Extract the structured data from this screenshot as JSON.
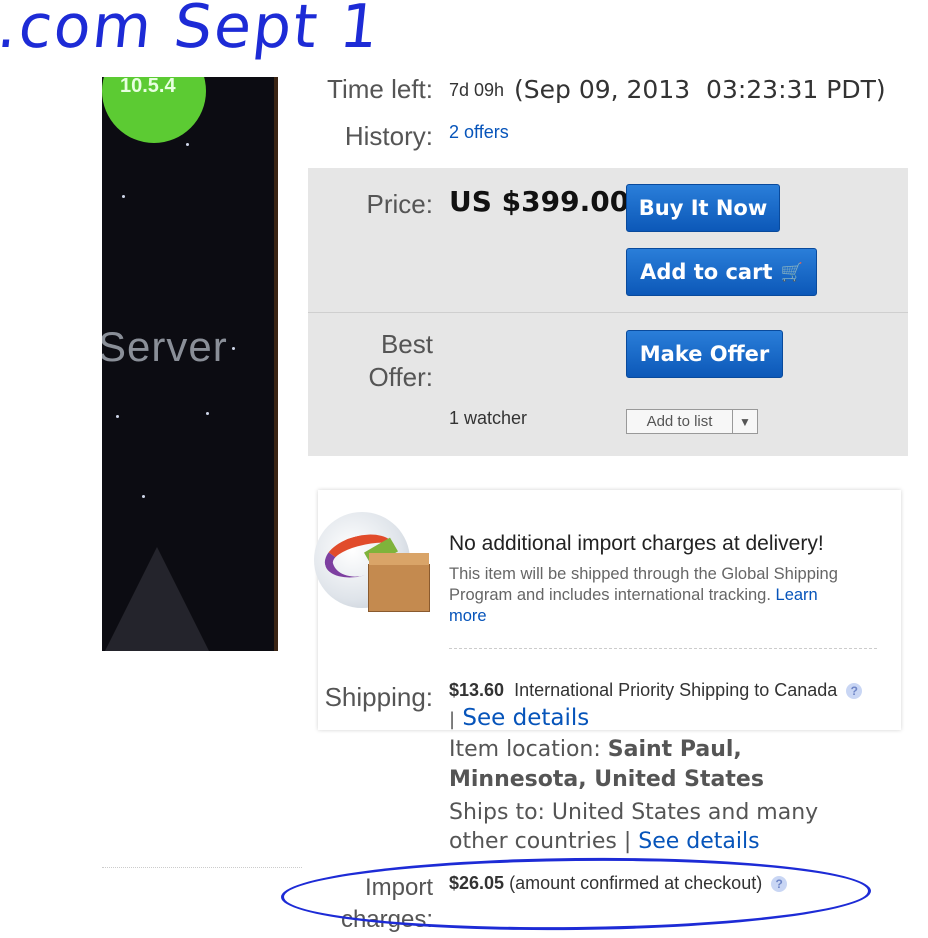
{
  "annotation": {
    "text": ".com  Sept  1",
    "color": "#1d2bd6"
  },
  "product_image": {
    "badge": "10.5.4",
    "text": "Server"
  },
  "listing": {
    "time_left_label": "Time left:",
    "time_left_short": "7d 09h",
    "time_left_end": "(Sep 09, 2013  03:23:31 PDT)",
    "history_label": "History:",
    "history_value": "2 offers",
    "price_label": "Price:",
    "price_value": "US $399.00",
    "buy_now_button": "Buy It Now",
    "add_to_cart_button": "Add to cart",
    "best_offer_label_1": "Best",
    "best_offer_label_2": "Offer:",
    "make_offer_button": "Make Offer",
    "watchers": "1 watcher",
    "add_to_list": "Add to list"
  },
  "global_shipping": {
    "title": "No additional import charges at delivery!",
    "description": "This item will be shipped through the Global Shipping Program and includes international tracking.",
    "learn": "Learn",
    "more": "more"
  },
  "shipping": {
    "label": "Shipping:",
    "cost": "$13.60",
    "service": "International Priority Shipping to Canada",
    "see_details": "See details",
    "location_label": "Item location:",
    "location_line1": "Saint Paul,",
    "location_line2": "Minnesota, United States",
    "ships_to_line1": "Ships to: United States and many",
    "ships_to_line2": "other countries",
    "see_details_2": "See details"
  },
  "import_charges": {
    "label_1": "Import",
    "label_2": "charges:",
    "amount": "$26.05",
    "note": "(amount confirmed at checkout)"
  },
  "colors": {
    "button": "#0c58b8",
    "link": "#0654ba",
    "price_box": "#e6e6e6"
  }
}
